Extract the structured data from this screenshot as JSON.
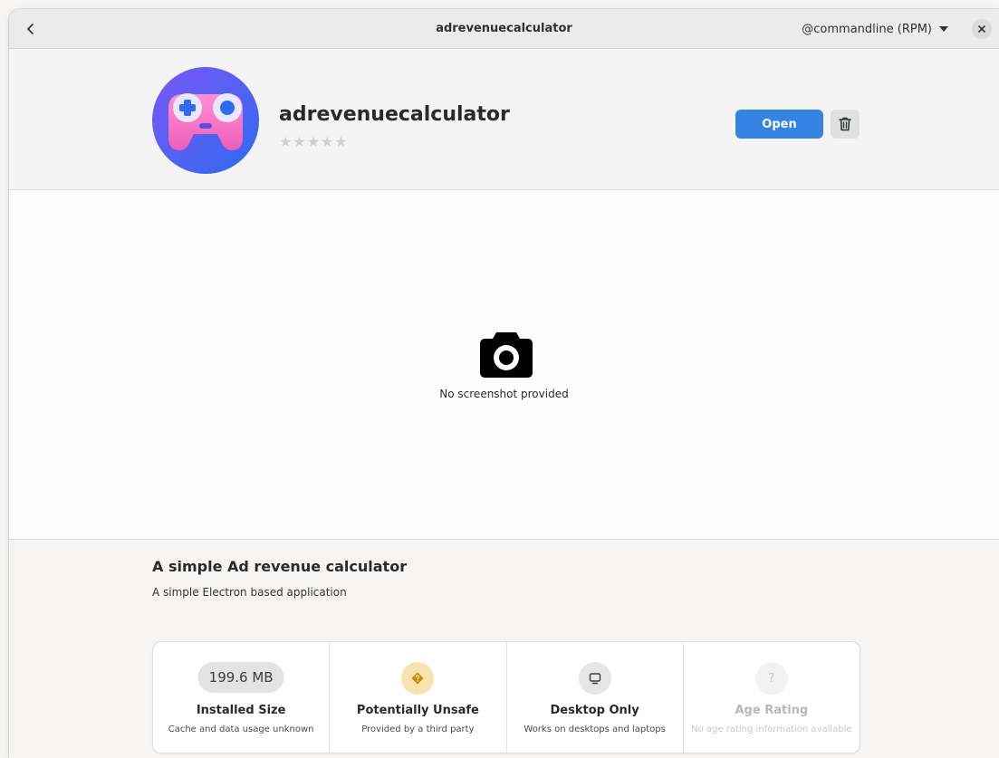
{
  "window": {
    "title": "adrevenuecalculator"
  },
  "header": {
    "source": "@commandline (RPM)"
  },
  "app": {
    "name": "adrevenuecalculator",
    "stars": "★★★★★",
    "open_label": "Open",
    "icon": "gamepad-app-icon"
  },
  "screenshot": {
    "placeholder": "No screenshot provided"
  },
  "details": {
    "summary": "A simple Ad revenue calculator",
    "description": "A simple Electron based application"
  },
  "tiles": [
    {
      "badge": "199.6 MB",
      "title": "Installed Size",
      "subtitle": "Cache and data usage unknown"
    },
    {
      "badge": "❖",
      "title": "Potentially Unsafe",
      "subtitle": "Provided by a third party"
    },
    {
      "badge": "",
      "title": "Desktop Only",
      "subtitle": "Works on desktops and laptops"
    },
    {
      "badge": "?",
      "title": "Age Rating",
      "subtitle": "No age rating information available"
    }
  ],
  "colors": {
    "accent": "#3584e4",
    "warning_badge_bg": "#f8e3b0",
    "warning_badge_fg": "#c28b00"
  }
}
